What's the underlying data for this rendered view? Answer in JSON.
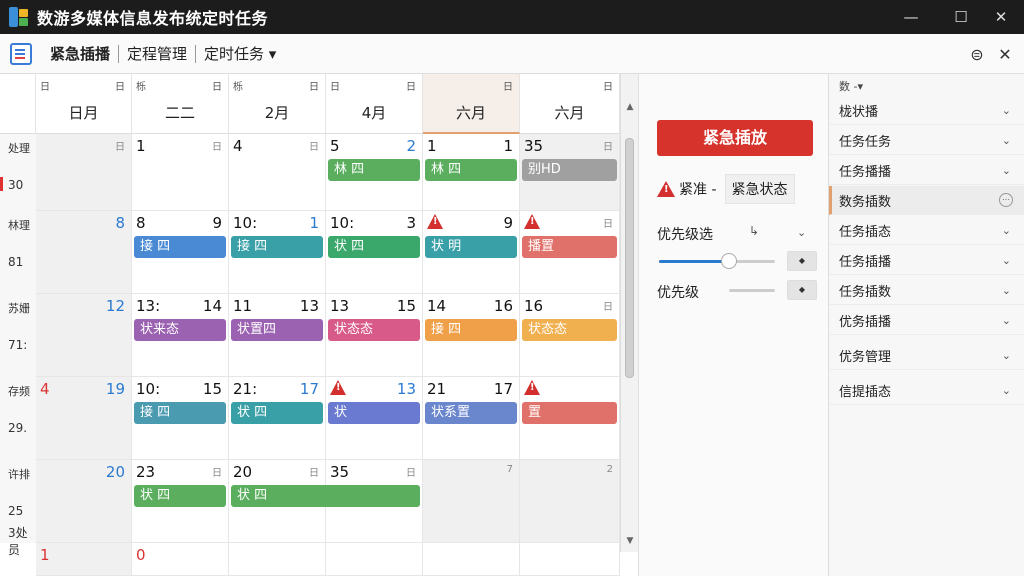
{
  "window": {
    "title": "数游多媒体信息发布统定时任务",
    "controls": {
      "minimize": "—",
      "maximize": "☐",
      "close": "✕"
    }
  },
  "toolbar": {
    "items": [
      "紧急插播",
      "定程管理",
      "定时任务 ▾"
    ],
    "right_icons": {
      "circle": "⊜",
      "close": "✕"
    }
  },
  "calendar": {
    "header_tiny": [
      [
        "日",
        "日"
      ],
      [
        "栎",
        "日"
      ],
      [
        "栎",
        "日"
      ],
      [
        "日",
        "日"
      ],
      [
        "",
        "日"
      ],
      [
        "",
        "日"
      ]
    ],
    "days": [
      "日月",
      "二二",
      "2月",
      "4月",
      "六月",
      "六月"
    ],
    "week_labels": [
      [
        "处理",
        "30"
      ],
      [
        "林理",
        "81"
      ],
      [
        "苏姗",
        "71:"
      ],
      [
        "存频",
        "29."
      ],
      [
        "许排",
        "25",
        "3处员"
      ]
    ],
    "rows": [
      {
        "cells": [
          {
            "dl": "",
            "dr": "日",
            "drStyle": "small",
            "gray": true
          },
          {
            "dl": "1",
            "dr": "日",
            "drStyle": "small"
          },
          {
            "dl": "4",
            "dr": "日",
            "drStyle": "small"
          },
          {
            "dl": "5",
            "dr": "2",
            "drStyle": "blue"
          },
          {
            "dl": "1",
            "dr": "1"
          },
          {
            "dl": "35",
            "dr": "日",
            "drStyle": "small",
            "gray": true
          }
        ],
        "events": [
          {
            "col": 3,
            "span": 1,
            "text": "林 四",
            "color": "#5aae5e"
          },
          {
            "col": 4,
            "span": 1,
            "text": "林 四",
            "color": "#5aae5e"
          },
          {
            "col": 5,
            "span": 1,
            "text": "别HD",
            "color": "#a0a0a0"
          }
        ]
      },
      {
        "cells": [
          {
            "dl": "",
            "dr": "8",
            "drStyle": "blue",
            "gray": true
          },
          {
            "dl": "8",
            "dr": "9"
          },
          {
            "dl": "10:",
            "dr": "1",
            "drStyle": "blue"
          },
          {
            "dl": "10:",
            "dr": "3"
          },
          {
            "warn": true,
            "dr": "9"
          },
          {
            "warn": true,
            "dr": "日",
            "drStyle": "small"
          }
        ],
        "events": [
          {
            "col": 1,
            "span": 1,
            "text": "接 四",
            "color": "#4a8ad4"
          },
          {
            "col": 2,
            "span": 1,
            "text": "接 四",
            "color": "#3aa0a8"
          },
          {
            "col": 3,
            "span": 1,
            "text": "状 四",
            "color": "#3aa86a"
          },
          {
            "col": 4,
            "span": 1,
            "text": "状 明",
            "color": "#3aa0a8"
          },
          {
            "col": 5,
            "span": 1,
            "text": "播置",
            "color": "#e0706a"
          }
        ]
      },
      {
        "cells": [
          {
            "dl": "",
            "dr": "12",
            "drStyle": "blue",
            "gray": true
          },
          {
            "dl": "13:",
            "dr": "14"
          },
          {
            "dl": "11",
            "dr": "13"
          },
          {
            "dl": "13",
            "dr": "15"
          },
          {
            "dl": "14",
            "dr": "16"
          },
          {
            "dl": "16",
            "dr": "日",
            "drStyle": "small"
          }
        ],
        "events": [
          {
            "col": 1,
            "span": 1,
            "text": "状来态",
            "color": "#9a62b0"
          },
          {
            "col": 2,
            "span": 1,
            "text": "状置四",
            "color": "#9a62b0"
          },
          {
            "col": 3,
            "span": 1,
            "text": "状态态",
            "color": "#d85a88"
          },
          {
            "col": 4,
            "span": 1,
            "text": "接 四",
            "color": "#f0a048"
          },
          {
            "col": 5,
            "span": 1,
            "text": "状态态",
            "color": "#f0b050"
          }
        ]
      },
      {
        "cells": [
          {
            "dl": "4",
            "dlStyle": "red",
            "dr": "19",
            "drStyle": "blue",
            "gray": true
          },
          {
            "dl": "10:",
            "dr": "15"
          },
          {
            "dl": "21:",
            "dr": "17",
            "drStyle": "blue"
          },
          {
            "warn": true,
            "dr": "13",
            "drStyle": "blue"
          },
          {
            "dl": "21",
            "dr": "17"
          },
          {
            "warn": true,
            "dr": ""
          }
        ],
        "events": [
          {
            "col": 1,
            "span": 1,
            "text": "接 四",
            "color": "#4a9ab0"
          },
          {
            "col": 2,
            "span": 1,
            "text": "状 四",
            "color": "#3aa0a8"
          },
          {
            "col": 3,
            "span": 1,
            "text": "状",
            "color": "#6a7ad0"
          },
          {
            "col": 4,
            "span": 1,
            "text": "状系置",
            "color": "#6a86cc"
          },
          {
            "col": 5,
            "span": 1,
            "text": "置",
            "color": "#e0706a"
          }
        ]
      },
      {
        "cells": [
          {
            "dl": "",
            "dr": "20",
            "drStyle": "blue",
            "gray": true
          },
          {
            "dl": "23",
            "dr": "日",
            "drStyle": "small"
          },
          {
            "dl": "20",
            "dr": "日",
            "drStyle": "small"
          },
          {
            "dl": "35",
            "dr": "日",
            "drStyle": "small"
          },
          {
            "dl": "",
            "dr": "7",
            "drStyle": "small",
            "gray": true
          },
          {
            "dl": "",
            "dr": "2",
            "drStyle": "small",
            "gray": true
          }
        ],
        "events": [
          {
            "col": 1,
            "span": 1,
            "text": "状 四",
            "color": "#5aae5e"
          },
          {
            "col": 2,
            "span": 2,
            "text": "状 四",
            "color": "#5aae5e"
          }
        ]
      },
      {
        "cells": [
          {
            "dl": "1",
            "dlStyle": "red",
            "dr": "",
            "gray": true
          },
          {
            "dl": "0",
            "dlStyle": "red",
            "dr": ""
          },
          {
            "dl": "",
            "dr": ""
          },
          {
            "dl": "",
            "dr": ""
          },
          {
            "dl": "",
            "dr": ""
          },
          {
            "dl": "",
            "dr": ""
          }
        ],
        "events": []
      }
    ]
  },
  "scrollbar": {
    "up": "▲",
    "down": "▼"
  },
  "panel": {
    "emergency_button": "紧急插放",
    "status_label": "紧准 -",
    "status_value": "紧急状态",
    "priority_label": "优先级选",
    "priority_select": "↳",
    "priority_value": 0.6,
    "priority2_label": "优先级",
    "spin_icon": "◆"
  },
  "sidebar": {
    "header": "数 -▾",
    "items": [
      {
        "label": "栊状播",
        "icon": "chevron-down"
      },
      {
        "label": "任务任务",
        "icon": "chevron-down"
      },
      {
        "label": "任务播播",
        "icon": "chevron-down"
      },
      {
        "label": "数务插数",
        "icon": "circle",
        "selected": true
      },
      {
        "label": "任务插态",
        "icon": "chevron-down"
      },
      {
        "label": "任务插播",
        "icon": "chevron-down"
      },
      {
        "label": "任务插数",
        "icon": "chevron-down"
      },
      {
        "label": "优务插播",
        "icon": "chevron-down"
      },
      {
        "label": "优务管理",
        "icon": "chevron-down"
      },
      {
        "label": "信提插态",
        "icon": "chevron-down"
      }
    ]
  }
}
